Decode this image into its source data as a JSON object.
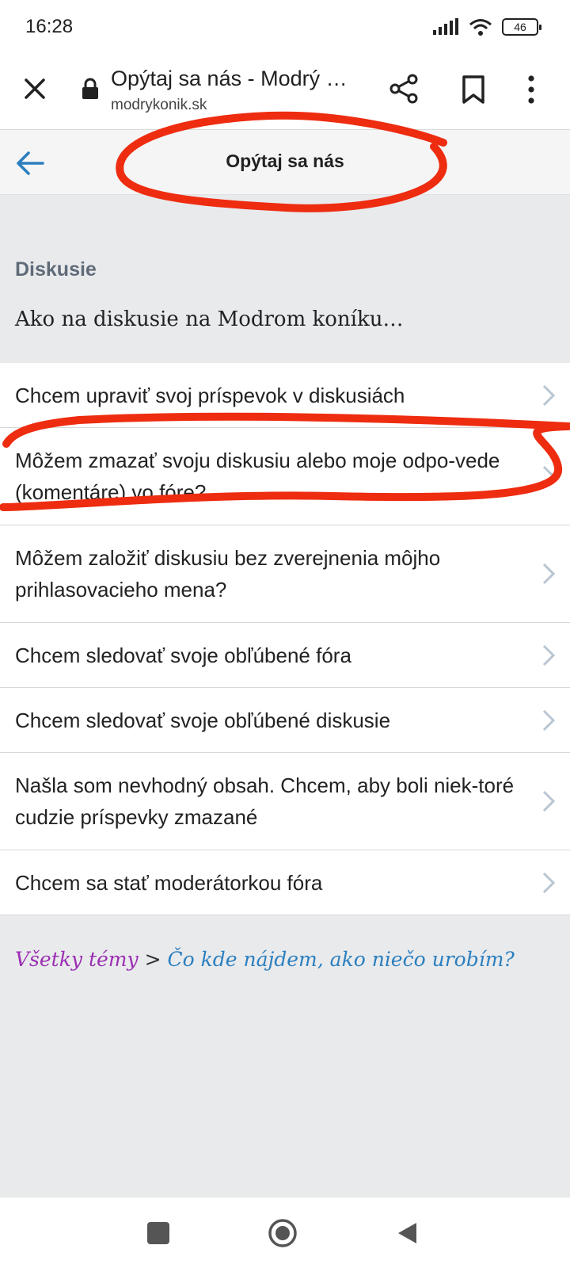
{
  "status_bar": {
    "time": "16:28",
    "battery": "46",
    "icons": [
      "signal-icon",
      "wifi-icon",
      "battery-icon"
    ]
  },
  "browser": {
    "title": "Opýtaj sa nás - Modrý …",
    "url": "modrykonik.sk",
    "icons": [
      "close-icon",
      "lock-icon",
      "share-icon",
      "bookmark-icon",
      "more-vert-icon"
    ]
  },
  "page": {
    "title": "Opýtaj sa nás",
    "back_icon": "arrow-left-icon",
    "section_heading": "Diskusie",
    "section_subtitle": "Ako na diskusie na Modrom koníku…"
  },
  "faq_items": [
    {
      "label": "Chcem upraviť svoj príspevok v diskusiách"
    },
    {
      "label": "Môžem zmazať svoju diskusiu alebo moje odpo-vede (komentáre) vo fóre?"
    },
    {
      "label": "Môžem založiť diskusiu bez zverejnenia môjho prihlasovacieho mena?"
    },
    {
      "label": "Chcem sledovať svoje obľúbené fóra"
    },
    {
      "label": "Chcem sledovať svoje obľúbené diskusie"
    },
    {
      "label": "Našla som nevhodný obsah. Chcem, aby boli niek-toré cudzie príspevky zmazané"
    },
    {
      "label": "Chcem sa stať moderátorkou fóra"
    }
  ],
  "breadcrumb": {
    "all_topics": "Všetky témy",
    "separator": ">",
    "current": "Čo kde nájdem, ako niečo urobím?"
  },
  "colors": {
    "accent_blue": "#2b7fbf",
    "breadcrumb_purple": "#9b2fb3",
    "annotation_red": "#ee2c10",
    "section_heading": "#5f6b78"
  },
  "nav_bar": {
    "icons": [
      "recent-apps-icon",
      "home-icon",
      "back-triangle-icon"
    ]
  }
}
